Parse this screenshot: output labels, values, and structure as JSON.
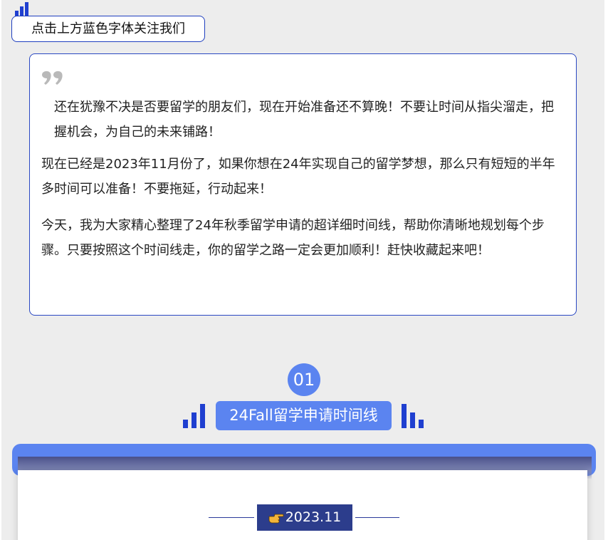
{
  "header": {
    "follow_label": "点击上方蓝色字体关注我们"
  },
  "intro": {
    "paragraphs": [
      "还在犹豫不决是否要留学的朋友们，现在开始准备还不算晚！不要让时间从指尖溜走，把握机会，为自己的未来铺路！",
      "现在已经是2023年11月份了，如果你想在24年实现自己的留学梦想，那么只有短短的半年多时间可以准备！不要拖延，行动起来！",
      "今天，我为大家精心整理了24年秋季留学申请的超详细时间线，帮助你清晰地规划每个步骤。只要按照这个时间线走，你的留学之路一定会更加顺利！赶快收藏起来吧！"
    ]
  },
  "section": {
    "number": "01",
    "title": "24Fall留学申请时间线"
  },
  "timeline": {
    "date_label": "2023.11"
  },
  "icons": {
    "top": "bar-chart-icon",
    "quote": "quote-icon",
    "left_bars": "bar-chart-icon",
    "right_bars": "bar-chart-icon",
    "date": "pointing-hand-icon"
  },
  "colors": {
    "accent_blue": "#5b84f0",
    "border_blue": "#2a48c2",
    "navy": "#2c3d8c",
    "background": "#ededed"
  }
}
